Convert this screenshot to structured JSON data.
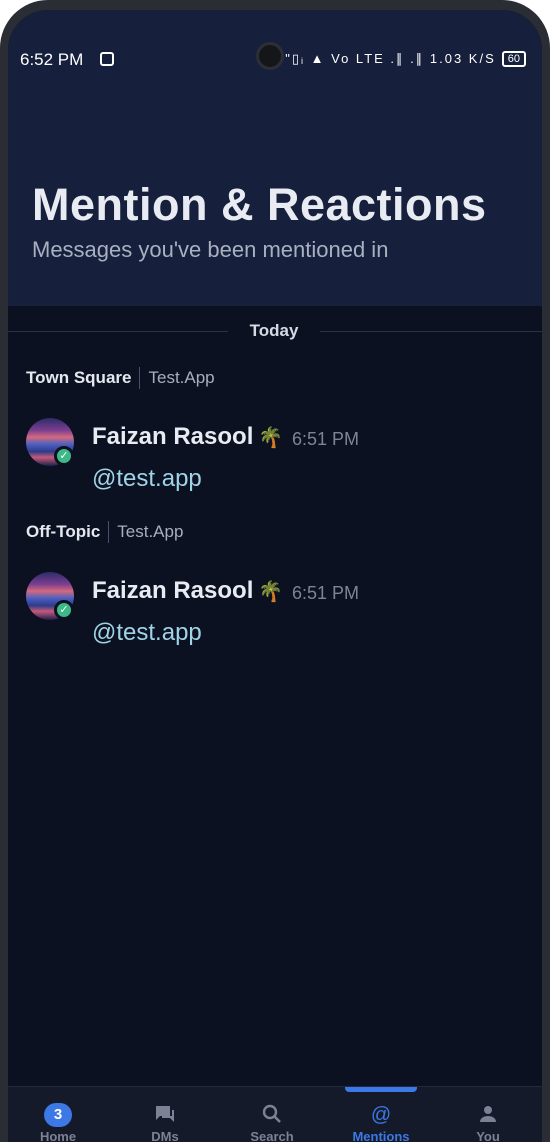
{
  "status_bar": {
    "time": "6:52 PM",
    "right_indicators": "\"▯ᵢ ▲ Vo LTE .∥ .∥ 1.03 K/S",
    "battery": "60"
  },
  "header": {
    "title": "Mention & Reactions",
    "subtitle": "Messages you've been mentioned in"
  },
  "date_separator": "Today",
  "mentions": [
    {
      "channel": "Town Square",
      "team": "Test.App",
      "author": "Faizan Rasool",
      "emoji": "🌴",
      "time": "6:51 PM",
      "message": "@test.app"
    },
    {
      "channel": "Off-Topic",
      "team": "Test.App",
      "author": "Faizan Rasool",
      "emoji": "🌴",
      "time": "6:51 PM",
      "message": "@test.app"
    }
  ],
  "tabs": [
    {
      "label": "Home",
      "icon": "home-icon",
      "badge": "3"
    },
    {
      "label": "DMs",
      "icon": "chat-icon"
    },
    {
      "label": "Search",
      "icon": "search-icon"
    },
    {
      "label": "Mentions",
      "icon": "at-icon",
      "active": true
    },
    {
      "label": "You",
      "icon": "person-icon"
    }
  ],
  "colors": {
    "background": "#0b1120",
    "header": "#161f3b",
    "accent": "#3c78e6",
    "online": "#3db887",
    "mention_text": "#9fd3e7"
  }
}
